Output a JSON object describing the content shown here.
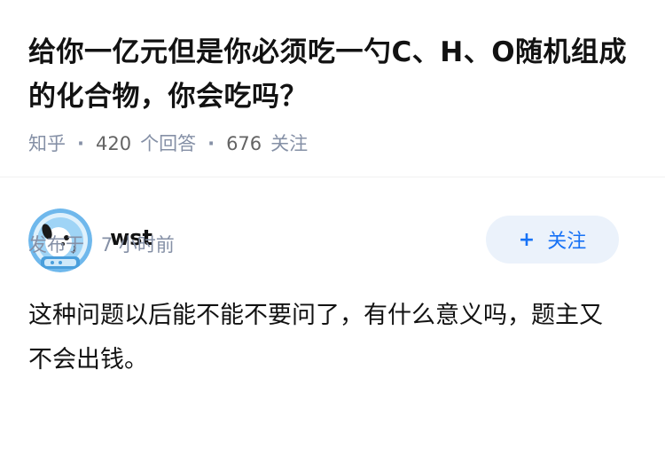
{
  "question": {
    "title": "给你一亿元但是你必须吃一勺C、H、O随机组成的化合物，你会吃吗？",
    "source": "知乎",
    "answer_count": "420",
    "answer_label": "个回答",
    "follower_count": "676",
    "follower_label": "关注"
  },
  "answer": {
    "author": {
      "name": "wst",
      "avatar_icon": "astronaut-dog-avatar"
    },
    "follow_button": {
      "plus": "+",
      "label": "关注"
    },
    "content": "这种问题以后能不能不要问了，有什么意义吗，题主又不会出钱。",
    "published_label": "发布于",
    "published_time": "7 小时前"
  },
  "colors": {
    "accent": "#1772f6",
    "follow_bg": "#ebf2fb",
    "meta_text": "#8590a6"
  }
}
